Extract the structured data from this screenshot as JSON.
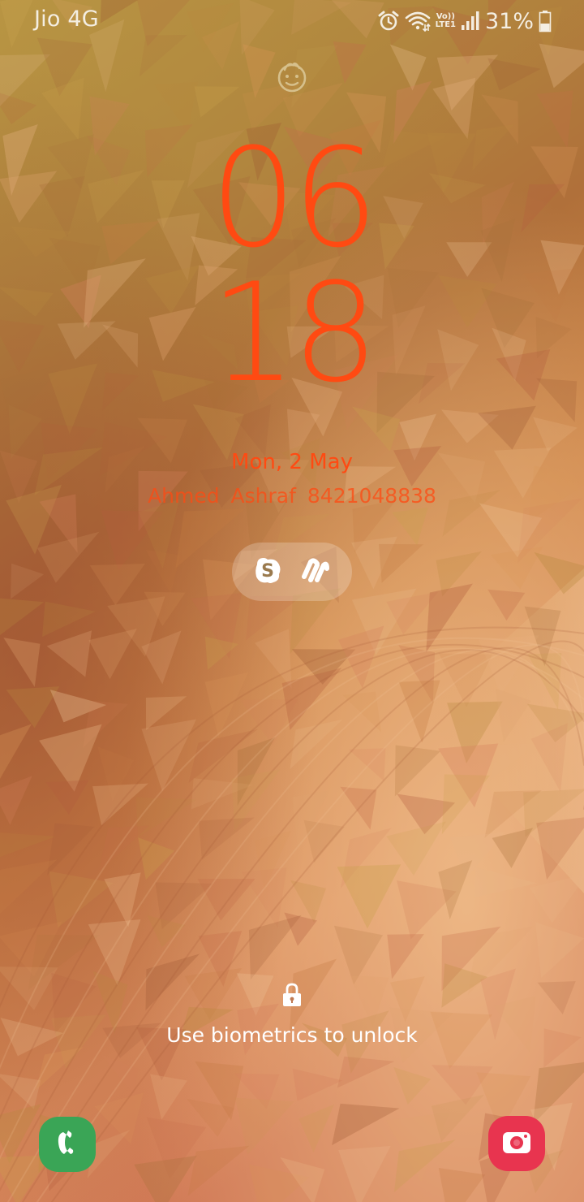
{
  "status_bar": {
    "carrier": "Jio 4G",
    "volte_top": "Vo))",
    "volte_bottom": "LTE1",
    "battery_percent": "31%",
    "icons": [
      "alarm-icon",
      "wifi-icon",
      "volte-icon",
      "signal-icon",
      "battery-icon"
    ]
  },
  "lock_screen": {
    "face_icon": "face-recognition-icon",
    "clock_hours": "06",
    "clock_minutes": "18",
    "date": "Mon, 2 May",
    "owner_info": "Ahmed  Ashraf  8421048838",
    "notification_icons": [
      "skype-icon",
      "slack-icon"
    ],
    "lock_icon": "padlock-icon",
    "unlock_hint": "Use biometrics to unlock"
  },
  "shortcuts": {
    "left": "phone-icon",
    "right": "camera-icon"
  },
  "colors": {
    "clock": "#ff4a12",
    "phone_shortcut": "#3aa556",
    "camera_shortcut": "#e8344f"
  }
}
